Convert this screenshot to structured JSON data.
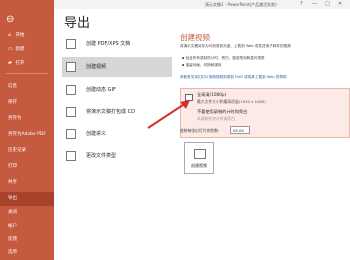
{
  "titlebar": {
    "title": "演示文稿1 - PowerPoint(产品激活失败)",
    "controls": [
      "?",
      "—",
      "□",
      "✕"
    ]
  },
  "sidebar": {
    "items": [
      {
        "label": "开始",
        "icon": "⌂"
      },
      {
        "label": "新建",
        "icon": "▭"
      },
      {
        "label": "打开",
        "icon": "▰"
      },
      {
        "label": "信息",
        "icon": ""
      },
      {
        "label": "保存",
        "icon": ""
      },
      {
        "label": "另存为",
        "icon": ""
      },
      {
        "label": "另存为Adobe PDF",
        "icon": ""
      },
      {
        "label": "历史记录",
        "icon": ""
      },
      {
        "label": "打印",
        "icon": ""
      },
      {
        "label": "共享",
        "icon": ""
      },
      {
        "label": "导出",
        "icon": ""
      },
      {
        "label": "关闭",
        "icon": ""
      },
      {
        "label": "帐户",
        "icon": ""
      },
      {
        "label": "反馈",
        "icon": ""
      },
      {
        "label": "选项",
        "icon": ""
      }
    ],
    "active_label": "导出",
    "colors": {
      "bg": "#c55a3e",
      "active": "#a7432b"
    }
  },
  "page": {
    "heading": "导出"
  },
  "options": [
    {
      "label": "创建 PDF/XPS 文档",
      "icon": "pdf-icon"
    },
    {
      "label": "创建视频",
      "icon": "video-icon"
    },
    {
      "label": "创建动态 GIF",
      "icon": "gif-icon"
    },
    {
      "label": "将演示文稿打包成 CD",
      "icon": "cd-icon"
    },
    {
      "label": "创建讲义",
      "icon": "handout-icon"
    },
    {
      "label": "更改文件类型",
      "icon": "file-type-icon"
    }
  ],
  "right": {
    "title": "创建视频",
    "desc1": "将演示文稿另存为可刻录到光盘、上载到 Web 或发送电子邮件的视频",
    "desc2": "",
    "bullets": [
      "包含所有录制的计时、旁白、墨迹笔划和激光笔势",
      "保留动画、切换和媒体"
    ],
    "link": "获取有关将幻灯片放映视频刻录到 DVD 或将其上载到 Web 的帮助",
    "quality_title": "全高清(1080p)",
    "quality_sub": "最大文件大小和最高质量(1920 x 1080)",
    "timing_title": "不要使用录制的计时和旁白",
    "timing_sub": "未录制任何计时或旁白",
    "seconds_label": "放映每张幻灯片的秒数:",
    "seconds_value": "05.00",
    "create_button": "创建视频"
  }
}
